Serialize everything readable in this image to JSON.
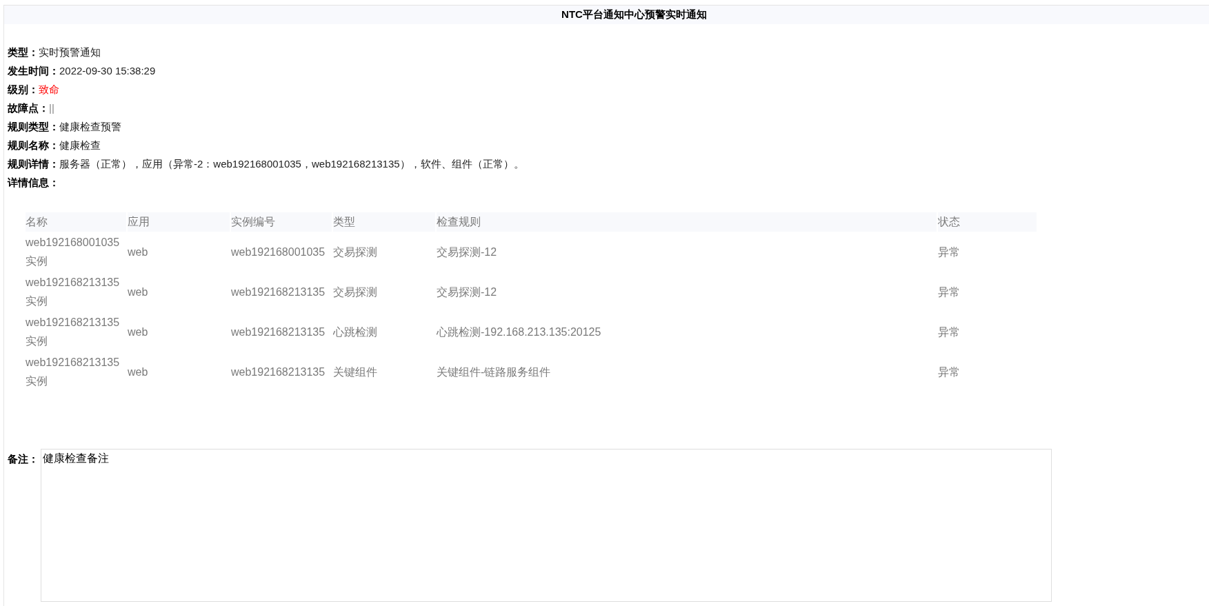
{
  "title": "NTC平台通知中心预警实时通知",
  "fields": [
    {
      "label": "类型：",
      "value": "实时预警通知",
      "kind": "plain"
    },
    {
      "label": "发生时间：",
      "value": "2022-09-30 15:38:29",
      "kind": "plain"
    },
    {
      "label": "级别：",
      "value": "致命",
      "kind": "alert"
    },
    {
      "label": "故障点：",
      "value": "||",
      "kind": "muted"
    },
    {
      "label": "规则类型：",
      "value": "健康检查预警",
      "kind": "plain"
    },
    {
      "label": "规则名称：",
      "value": "健康检查",
      "kind": "plain"
    },
    {
      "label": "规则详情：",
      "value": "服务器（正常），应用（异常-2：web192168001035，web192168213135），软件、组件（正常）。",
      "kind": "plain"
    },
    {
      "label": "详情信息："
    }
  ],
  "table": {
    "columns": [
      "名称",
      "应用",
      "实例编号",
      "类型",
      "检查规则",
      "状态"
    ],
    "rows": [
      [
        "web192168001035实例",
        "web",
        "web192168001035",
        "交易探测",
        "交易探测-12",
        "异常"
      ],
      [
        "web192168213135实例",
        "web",
        "web192168213135",
        "交易探测",
        "交易探测-12",
        "异常"
      ],
      [
        "web192168213135实例",
        "web",
        "web192168213135",
        "心跳检测",
        "心跳检测-192.168.213.135:20125",
        "异常"
      ],
      [
        "web192168213135实例",
        "web",
        "web192168213135",
        "关键组件",
        "关键组件-链路服务组件",
        "异常"
      ]
    ]
  },
  "remark": {
    "label": "备注：",
    "value": "健康检查备注"
  }
}
